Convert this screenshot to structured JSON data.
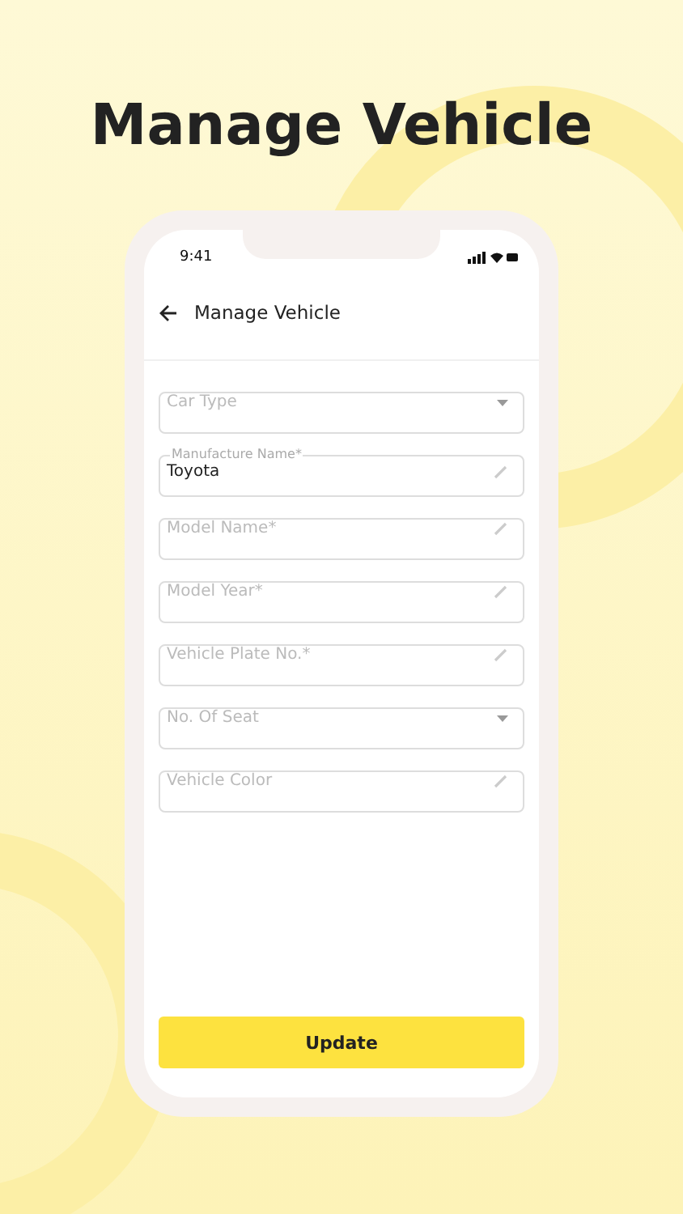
{
  "headline": "Manage Vehicle",
  "status_bar": {
    "time": "9:41"
  },
  "header": {
    "title": "Manage Vehicle"
  },
  "fields": [
    {
      "kind": "select",
      "placeholder": "Car Type"
    },
    {
      "kind": "text",
      "label": "Manufacture Name*",
      "value": "Toyota"
    },
    {
      "kind": "text",
      "placeholder": "Model Name*"
    },
    {
      "kind": "text",
      "placeholder": "Model Year*"
    },
    {
      "kind": "text",
      "placeholder": "Vehicle Plate No.*"
    },
    {
      "kind": "select",
      "placeholder": "No. Of Seat"
    },
    {
      "kind": "text",
      "placeholder": "Vehicle Color"
    }
  ],
  "button": "Update"
}
